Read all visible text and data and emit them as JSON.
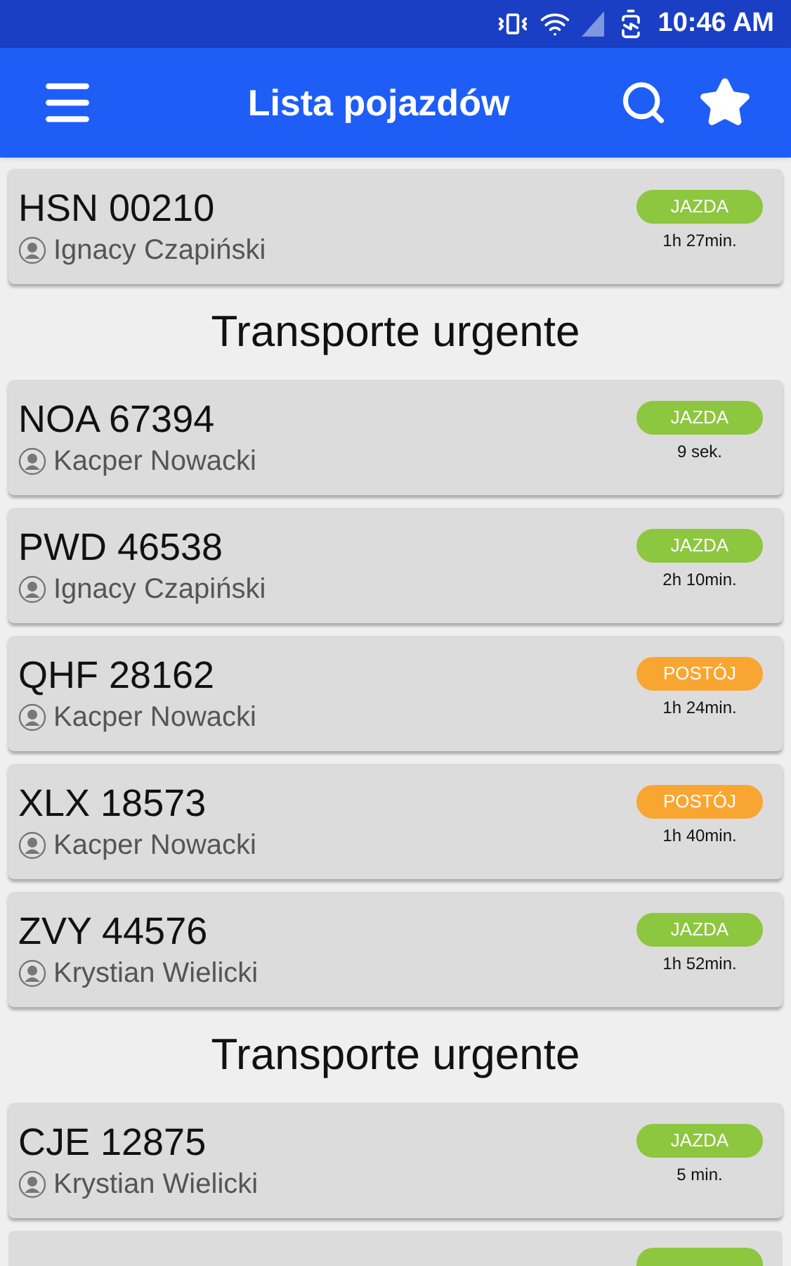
{
  "status_bar": {
    "time": "10:46 AM"
  },
  "app_bar": {
    "title": "Lista pojazdów"
  },
  "items": [
    {
      "kind": "vehicle",
      "plate": "HSN 00210",
      "driver": "Ignacy Czapiński",
      "status": "JAZDA",
      "color": "#8dc63f",
      "duration": "1h 27min."
    },
    {
      "kind": "section",
      "title": "Transporte urgente"
    },
    {
      "kind": "vehicle",
      "plate": "NOA 67394",
      "driver": "Kacper Nowacki",
      "status": "JAZDA",
      "color": "#8dc63f",
      "duration": "9 sek."
    },
    {
      "kind": "vehicle",
      "plate": "PWD 46538",
      "driver": "Ignacy Czapiński",
      "status": "JAZDA",
      "color": "#8dc63f",
      "duration": "2h 10min."
    },
    {
      "kind": "vehicle",
      "plate": "QHF 28162",
      "driver": "Kacper Nowacki",
      "status": "POSTÓJ",
      "color": "#f9a531",
      "duration": "1h 24min."
    },
    {
      "kind": "vehicle",
      "plate": "XLX 18573",
      "driver": "Kacper Nowacki",
      "status": "POSTÓJ",
      "color": "#f9a531",
      "duration": "1h 40min."
    },
    {
      "kind": "vehicle",
      "plate": "ZVY 44576",
      "driver": "Krystian Wielicki",
      "status": "JAZDA",
      "color": "#8dc63f",
      "duration": "1h 52min."
    },
    {
      "kind": "section",
      "title": "Transporte urgente"
    },
    {
      "kind": "vehicle",
      "plate": "CJE 12875",
      "driver": "Krystian Wielicki",
      "status": "JAZDA",
      "color": "#8dc63f",
      "duration": "5 min."
    },
    {
      "kind": "partial",
      "color": "#8dc63f"
    }
  ]
}
